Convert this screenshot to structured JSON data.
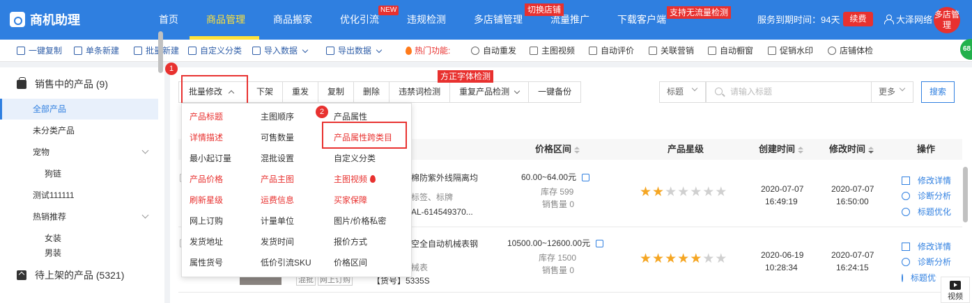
{
  "app": {
    "title": "商机助理"
  },
  "nav": {
    "items": [
      {
        "label": "首页"
      },
      {
        "label": "商品管理"
      },
      {
        "label": "商品搬家"
      },
      {
        "label": "优化引流"
      },
      {
        "label": "违规检测"
      },
      {
        "label": "多店铺管理"
      },
      {
        "label": "流量推广"
      },
      {
        "label": "下载客户端"
      }
    ],
    "new_badge": "NEW",
    "tag_switch_store": "切换店铺",
    "tag_no_traffic": "支持无流量检测",
    "service_expiry": "服务到期时间：94天",
    "renew": "续费",
    "username": "大泽网络",
    "multi_store_manage": "多店管理"
  },
  "toolbar": {
    "items": [
      "一键复制",
      "单条新建",
      "批量新建",
      "自定义分类",
      "导入数据",
      "导出数据",
      "热门功能:",
      "自动重发",
      "主图视频",
      "自动评价",
      "关联营销",
      "自动橱窗",
      "促销水印",
      "店铺体检"
    ],
    "badge": "68"
  },
  "sidebar": {
    "on_sale": "销售中的产品 (9)",
    "items": [
      {
        "label": "全部产品"
      },
      {
        "label": "未分类产品"
      },
      {
        "label": "宠物"
      },
      {
        "label": "狗链"
      },
      {
        "label": "测试111111"
      },
      {
        "label": "热销推荐"
      },
      {
        "label": "女装"
      },
      {
        "label": "男装"
      }
    ],
    "pending": "待上架的产品 (5321)"
  },
  "actions": {
    "buttons": [
      "批量修改",
      "下架",
      "重发",
      "复制",
      "删除",
      "违禁词检测",
      "重复产品检测",
      "一键备份"
    ],
    "font_check_tag": "方正字体检测",
    "step1": "1",
    "step2": "2"
  },
  "search": {
    "field": "标题",
    "placeholder": "请输入标题",
    "more": "更多",
    "button": "搜索"
  },
  "batch_menu": {
    "col1": [
      "产品标题",
      "详情描述",
      "最小起订量",
      "产品价格",
      "刷新星级",
      "网上订购",
      "发货地址",
      "属性货号"
    ],
    "col2": [
      "主图顺序",
      "可售数量",
      "混批设置",
      "产品主图",
      "运费信息",
      "计量单位",
      "发货时间",
      "低价引流SKU"
    ],
    "col3": [
      "产品属性",
      "产品属性跨类目",
      "自定义分类",
      "主图视频",
      "买家保障",
      "图片/价格私密",
      "报价方式",
      "价格区间"
    ]
  },
  "table": {
    "headers": [
      "价格区间",
      "产品星级",
      "创建时间",
      "修改时间",
      "操作"
    ],
    "rows": [
      {
        "title": "棉防紫外线隔离均",
        "subtitle": "标签、标牌",
        "code": "AL-614549370...",
        "price": "60.00~64.00元",
        "stock": "库存 599",
        "sales": "销售量 0",
        "stars": 2,
        "created_date": "2020-07-07",
        "created_time": "16:49:19",
        "modified_date": "2020-07-07",
        "modified_time": "16:50:00",
        "ops": [
          "修改详情",
          "诊断分析",
          "标题优化"
        ]
      },
      {
        "title": "空全自动机械表钢",
        "subtitle": "械表",
        "tags": [
          "混批",
          "网上订购"
        ],
        "code": "【货号】5335S",
        "price": "10500.00~12600.00元",
        "stock": "库存 1500",
        "sales": "销售量 0",
        "stars": 5,
        "created_date": "2020-06-19",
        "created_time": "10:28:34",
        "modified_date": "2020-07-07",
        "modified_time": "16:24:15",
        "ops": [
          "修改详情",
          "诊断分析",
          "标题优化"
        ]
      }
    ]
  },
  "video_btn": "视频",
  "colors": {
    "primary": "#2f7fe0",
    "accent": "#ffe23a",
    "danger": "#e8312f",
    "star": "#f5a623"
  }
}
